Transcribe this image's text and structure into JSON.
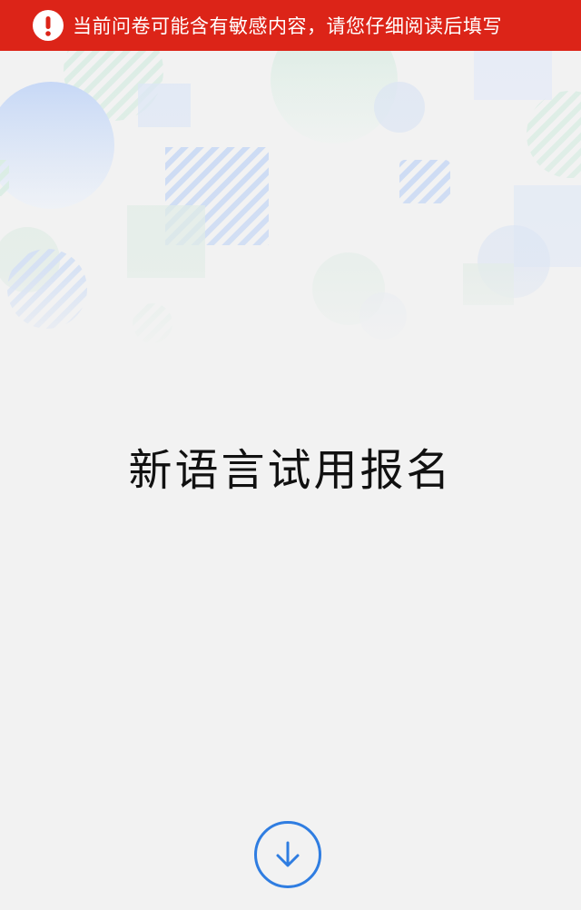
{
  "warning": {
    "text": "当前问卷可能含有敏感内容，请您仔细阅读后填写",
    "icon": "exclamation-icon",
    "background_color": "#dc2418"
  },
  "survey": {
    "title": "新语言试用报名"
  },
  "scroll_button": {
    "icon": "arrow-down-icon",
    "color": "#2f7de1"
  }
}
